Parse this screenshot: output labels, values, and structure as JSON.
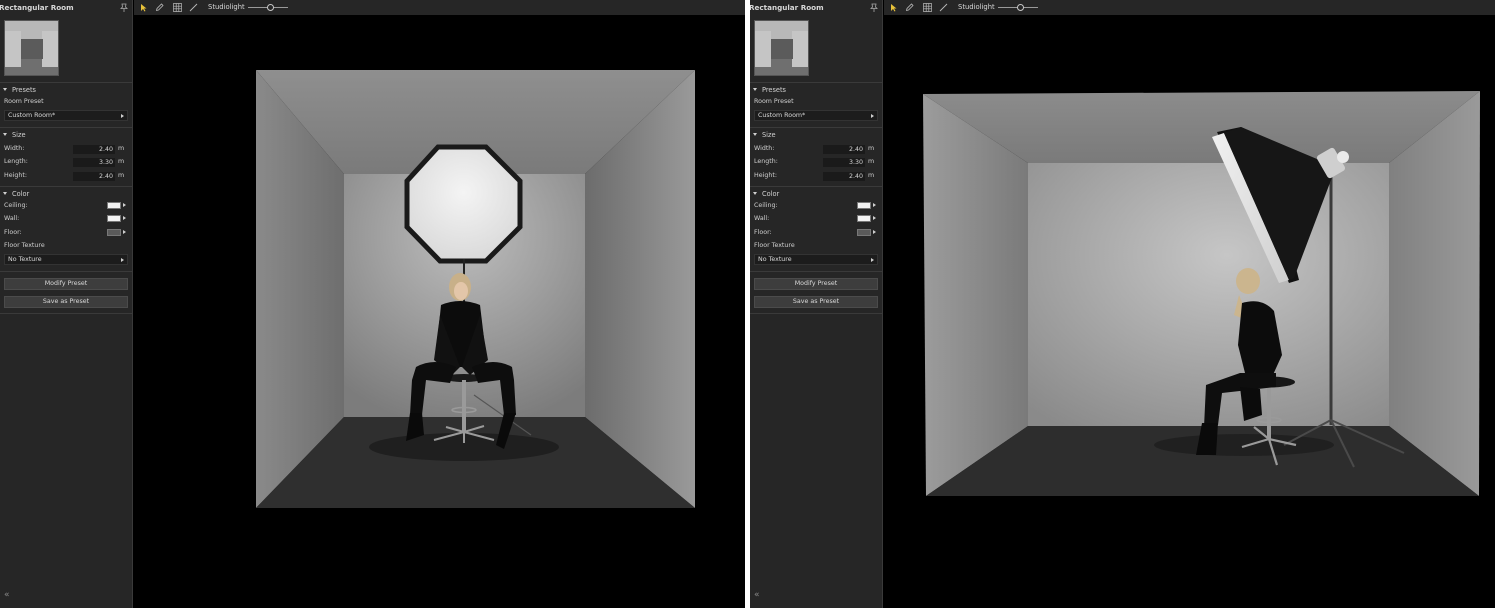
{
  "panels": [
    {
      "title": "Rectangular Room",
      "presets": {
        "header": "Presets",
        "room_preset_label": "Room Preset",
        "room_preset_value": "Custom Room*"
      },
      "size": {
        "header": "Size",
        "width_label": "Width:",
        "width": "2.40",
        "length_label": "Length:",
        "length": "3.30",
        "height_label": "Height:",
        "height": "2.40",
        "unit": "m"
      },
      "color": {
        "header": "Color",
        "ceiling_label": "Ceiling:",
        "wall_label": "Wall:",
        "floor_label": "Floor:",
        "floor_texture_label": "Floor Texture",
        "floor_texture_value": "No Texture"
      },
      "buttons": {
        "modify": "Modify Preset",
        "save": "Save as Preset"
      },
      "toolbar": {
        "studiolight_label": "Studiolight"
      },
      "collapse": "«"
    },
    {
      "title": "Rectangular Room",
      "presets": {
        "header": "Presets",
        "room_preset_label": "Room Preset",
        "room_preset_value": "Custom Room*"
      },
      "size": {
        "header": "Size",
        "width_label": "Width:",
        "width": "2.40",
        "length_label": "Length:",
        "length": "3.30",
        "height_label": "Height:",
        "height": "2.40",
        "unit": "m"
      },
      "color": {
        "header": "Color",
        "ceiling_label": "Ceiling:",
        "wall_label": "Wall:",
        "floor_label": "Floor:",
        "floor_texture_label": "Floor Texture",
        "floor_texture_value": "No Texture"
      },
      "buttons": {
        "modify": "Modify Preset",
        "save": "Save as Preset"
      },
      "toolbar": {
        "studiolight_label": "Studiolight"
      },
      "collapse": "«"
    }
  ],
  "colors": {
    "ceiling_swatch": "#f2f2f2",
    "wall_swatch": "#f2f2f2",
    "floor_swatch": "#5a5a5a",
    "select_tool_accent": "#e8c23a"
  },
  "icons": [
    "pin-icon",
    "select-arrow-icon",
    "pencil-icon",
    "grid-icon",
    "ruler-icon",
    "collapse-chevrons-icon"
  ]
}
